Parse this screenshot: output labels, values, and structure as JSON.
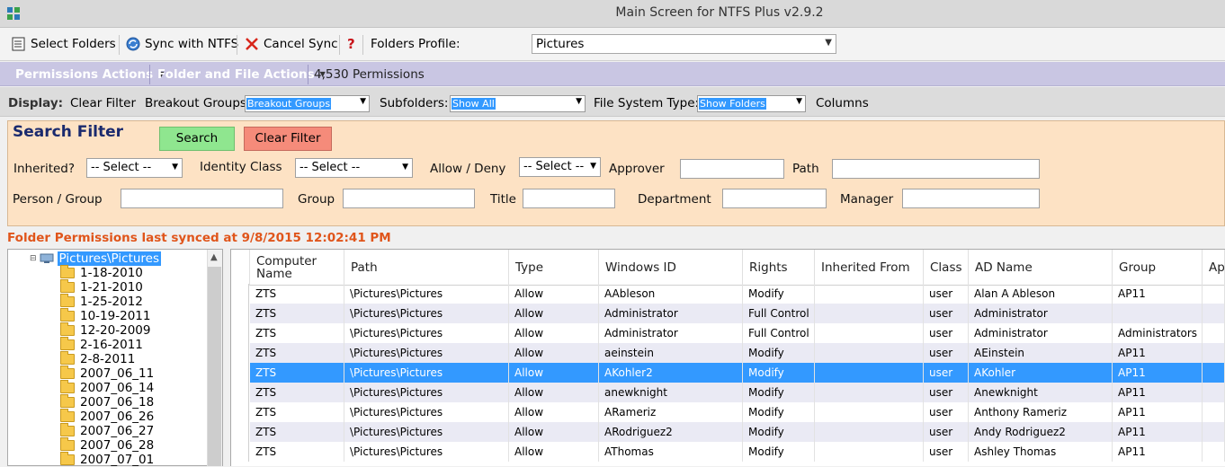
{
  "window": {
    "title": "Main Screen for NTFS Plus v2.9.2"
  },
  "toolbar": {
    "select_folders": "Select Folders",
    "sync_ntfs": "Sync with NTFS",
    "cancel_sync": "Cancel Sync",
    "help": "?",
    "profile_label": "Folders Profile:",
    "profile_value": "Pictures"
  },
  "actions": {
    "permissions_actions": "Permissions Actions",
    "folder_file_actions": "Folder and File Actions",
    "permission_count": "4,530 Permissions"
  },
  "display": {
    "label": "Display:",
    "clear_filter": "Clear Filter",
    "breakout_label": "Breakout Groups",
    "breakout_value": "Breakout Groups",
    "subfolders_label": "Subfolders:",
    "subfolders_value": "Show All",
    "fstype_label": "File System Type:",
    "fstype_value": "Show Folders",
    "columns": "Columns"
  },
  "filter": {
    "title": "Search Filter",
    "search": "Search",
    "clear": "Clear Filter",
    "inherited_label": "Inherited?",
    "inherited_value": "-- Select --",
    "identity_label": "Identity Class",
    "identity_value": "-- Select --",
    "allow_deny_label": "Allow / Deny",
    "allow_deny_value": "-- Select --",
    "approver_label": "Approver",
    "path_label": "Path",
    "person_group_label": "Person / Group",
    "group_label": "Group",
    "title_label": "Title",
    "department_label": "Department",
    "manager_label": "Manager"
  },
  "sync_status": "Folder Permissions last synced at 9/8/2015 12:02:41 PM",
  "tree": {
    "root": "Pictures\\Pictures",
    "folders": [
      "1-18-2010",
      "1-21-2010",
      "1-25-2012",
      "10-19-2011",
      "12-20-2009",
      "2-16-2011",
      "2-8-2011",
      "2007_06_11",
      "2007_06_14",
      "2007_06_18",
      "2007_06_26",
      "2007_06_27",
      "2007_06_28",
      "2007_07_01"
    ]
  },
  "grid": {
    "columns": [
      "Computer Name",
      "Path",
      "Type",
      "Windows ID",
      "Rights",
      "Inherited From",
      "Class",
      "AD Name",
      "Group",
      "Ap"
    ],
    "rows": [
      [
        "ZTS",
        "\\Pictures\\Pictures",
        "Allow",
        "AAbleson",
        "Modify",
        "",
        "user",
        "Alan A Ableson",
        "AP11"
      ],
      [
        "ZTS",
        "\\Pictures\\Pictures",
        "Allow",
        "Administrator",
        "Full Control",
        "",
        "user",
        "Administrator",
        ""
      ],
      [
        "ZTS",
        "\\Pictures\\Pictures",
        "Allow",
        "Administrator",
        "Full Control",
        "",
        "user",
        "Administrator",
        "Administrators"
      ],
      [
        "ZTS",
        "\\Pictures\\Pictures",
        "Allow",
        "aeinstein",
        "Modify",
        "",
        "user",
        "AEinstein",
        "AP11"
      ],
      [
        "ZTS",
        "\\Pictures\\Pictures",
        "Allow",
        "AKohler2",
        "Modify",
        "",
        "user",
        "AKohler",
        "AP11"
      ],
      [
        "ZTS",
        "\\Pictures\\Pictures",
        "Allow",
        "anewknight",
        "Modify",
        "",
        "user",
        "Anewknight",
        "AP11"
      ],
      [
        "ZTS",
        "\\Pictures\\Pictures",
        "Allow",
        "ARameriz",
        "Modify",
        "",
        "user",
        "Anthony Rameriz",
        "AP11"
      ],
      [
        "ZTS",
        "\\Pictures\\Pictures",
        "Allow",
        "ARodriguez2",
        "Modify",
        "",
        "user",
        "Andy Rodriguez2",
        "AP11"
      ],
      [
        "ZTS",
        "\\Pictures\\Pictures",
        "Allow",
        "AThomas",
        "Modify",
        "",
        "user",
        "Ashley Thomas",
        "AP11"
      ]
    ],
    "selected_row": 4
  }
}
